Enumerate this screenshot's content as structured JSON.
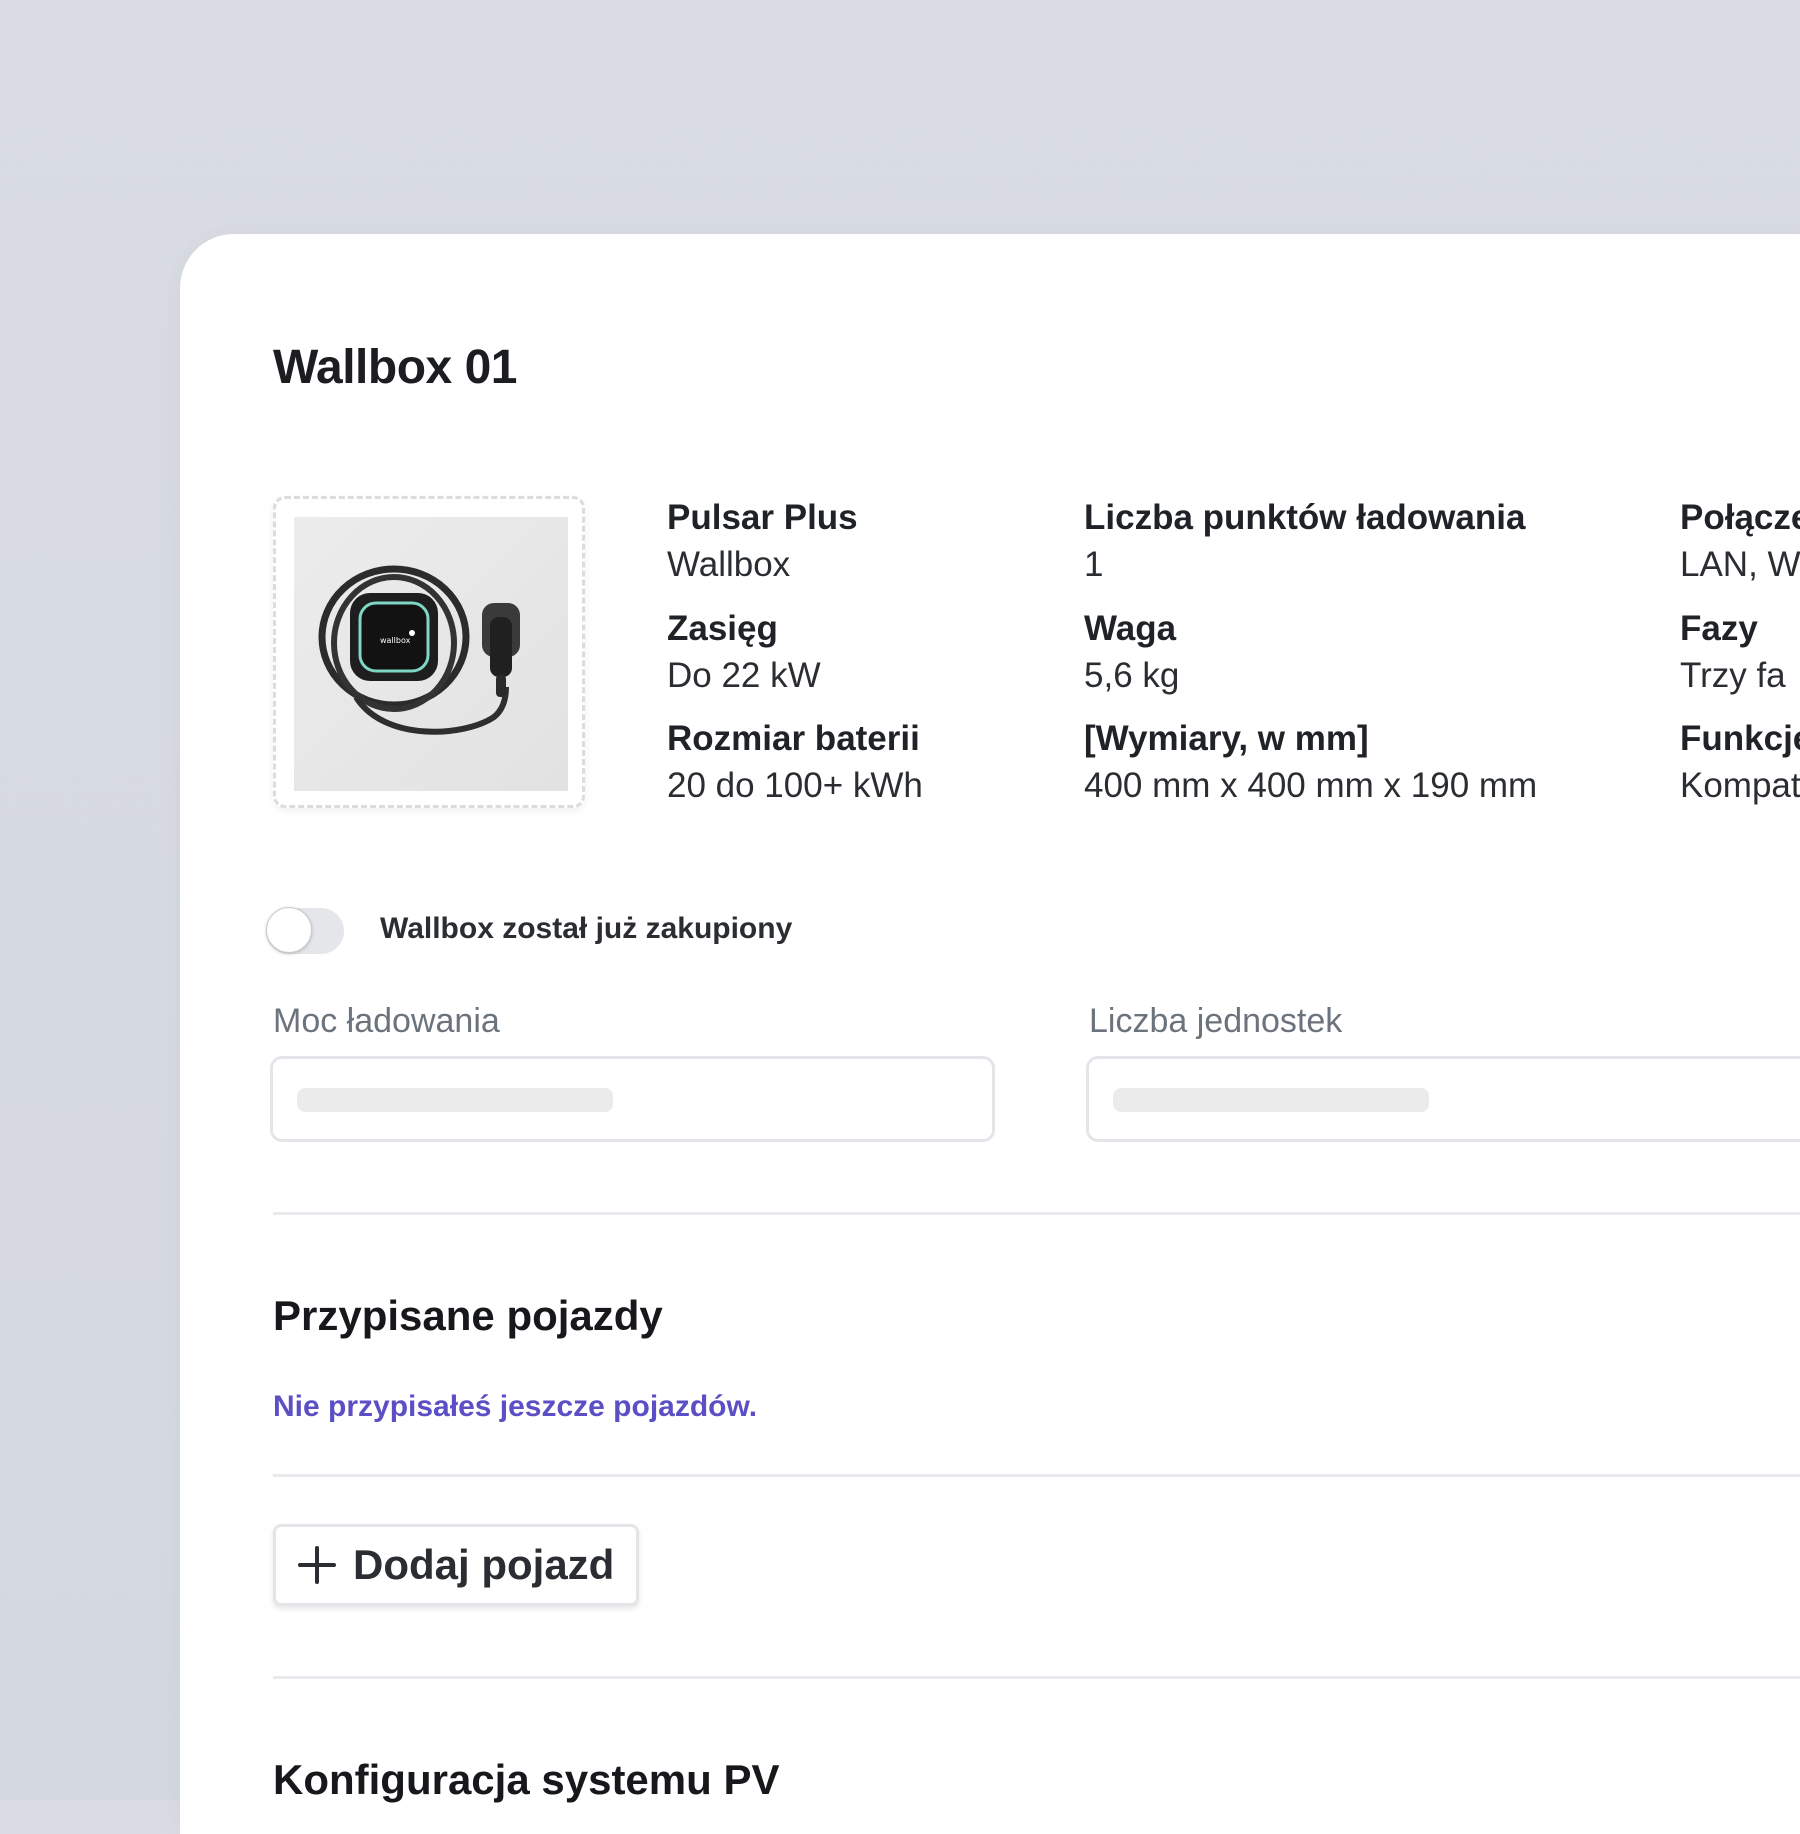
{
  "card": {
    "title": "Wallbox 01"
  },
  "product": {
    "image_alt": "Pulsar Plus Wallbox charger with cable",
    "brand_mark": "wallbox",
    "specs": [
      {
        "label": "Pulsar Plus",
        "value": "Wallbox"
      },
      {
        "label": "Zasięg",
        "value": "Do 22 kW"
      },
      {
        "label": "Rozmiar baterii",
        "value": "20 do 100+ kWh"
      },
      {
        "label": "Liczba punktów ładowania",
        "value": "1"
      },
      {
        "label": "Waga",
        "value": "5,6 kg"
      },
      {
        "label": "[Wymiary, w mm]",
        "value": "400 mm x 400 mm x 190 mm"
      },
      {
        "label": "Połącze",
        "value": "LAN, W"
      },
      {
        "label": "Fazy",
        "value": "Trzy fa"
      },
      {
        "label": "Funkcje",
        "value": "Kompat"
      }
    ]
  },
  "purchase_toggle": {
    "label": "Wallbox został już zakupiony",
    "checked": false
  },
  "fields": {
    "charging_power": {
      "label": "Moc ładowania",
      "value": ""
    },
    "unit_count": {
      "label": "Liczba jednostek",
      "value": ""
    }
  },
  "vehicles": {
    "heading": "Przypisane pojazdy",
    "empty_message": "Nie przypisałeś jeszcze pojazdów.",
    "add_button_label": "Dodaj pojazd"
  },
  "pv": {
    "heading": "Konfiguracja systemu PV"
  },
  "colors": {
    "accent_text": "#5a4fc4",
    "background": "#d7dbe1",
    "card": "#ffffff"
  }
}
